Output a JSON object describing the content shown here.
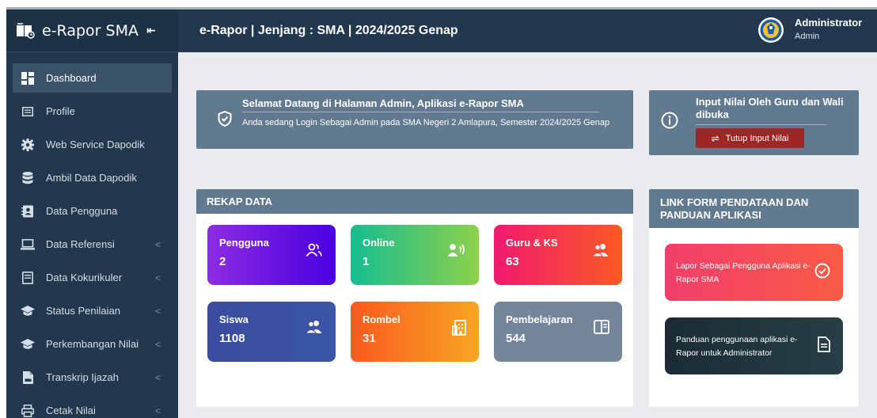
{
  "sidebar": {
    "brand": "e-Rapor SMA",
    "collapse_icon": "⇤",
    "items": [
      {
        "label": "Dashboard",
        "icon": "dashboard-icon",
        "active": true,
        "chevron": ""
      },
      {
        "label": "Profile",
        "icon": "id-card-icon",
        "active": false,
        "chevron": ""
      },
      {
        "label": "Web Service Dapodik",
        "icon": "gear-icon",
        "active": false,
        "chevron": ""
      },
      {
        "label": "Ambil Data Dapodik",
        "icon": "database-icon",
        "active": false,
        "chevron": ""
      },
      {
        "label": "Data Pengguna",
        "icon": "address-book-icon",
        "active": false,
        "chevron": ""
      },
      {
        "label": "Data Referensi",
        "icon": "laptop-icon",
        "active": false,
        "chevron": "<"
      },
      {
        "label": "Data Kokurikuler",
        "icon": "file-alt-icon",
        "active": false,
        "chevron": "<"
      },
      {
        "label": "Status Penilaian",
        "icon": "graduation-cap-icon",
        "active": false,
        "chevron": "<"
      },
      {
        "label": "Perkembangan Nilai",
        "icon": "graduation-cap-icon",
        "active": false,
        "chevron": "<"
      },
      {
        "label": "Transkrip Ijazah",
        "icon": "file-pdf-icon",
        "active": false,
        "chevron": "<"
      },
      {
        "label": "Cetak Nilai",
        "icon": "print-icon",
        "active": false,
        "chevron": "<"
      }
    ]
  },
  "header": {
    "title": "e-Rapor | Jenjang : SMA | 2024/2025 Genap",
    "user_name": "Administrator",
    "user_role": "Admin"
  },
  "welcome": {
    "title": "Selamat Datang di Halaman Admin, Aplikasi e-Rapor SMA",
    "text": "Anda sedang Login Sebagai Admin pada SMA Negeri 2 Amlapura, Semester 2024/2025 Genap"
  },
  "input_nilai": {
    "title": "Input Nilai Oleh Guru dan Wali dibuka",
    "button_label": "Tutup Input Nilai",
    "button_icon": "⇌"
  },
  "rekap": {
    "title": "REKAP DATA",
    "cards": [
      {
        "label": "Pengguna",
        "value": "2",
        "icon": "users-icon"
      },
      {
        "label": "Online",
        "value": "1",
        "icon": "user-online-icon"
      },
      {
        "label": "Guru & KS",
        "value": "63",
        "icon": "user-group-icon"
      },
      {
        "label": "Siswa",
        "value": "1108",
        "icon": "user-group-icon"
      },
      {
        "label": "Rombel",
        "value": "31",
        "icon": "building-icon"
      },
      {
        "label": "Pembelajaran",
        "value": "544",
        "icon": "book-open-icon"
      }
    ]
  },
  "links": {
    "title": "LINK FORM PENDATAAN DAN PANDUAN APLIKASI",
    "items": [
      {
        "text": "Lapor Sebagai Pengguna Aplikasi e-Rapor SMA",
        "icon": "check-circle-icon"
      },
      {
        "text": "Panduan penggunaan aplikasi e-Rapor untuk Administrator",
        "icon": "document-icon"
      }
    ]
  },
  "colors": {
    "sidebar_bg": "#22384e",
    "panel_header": "#627a8f",
    "danger": "#a02626"
  }
}
